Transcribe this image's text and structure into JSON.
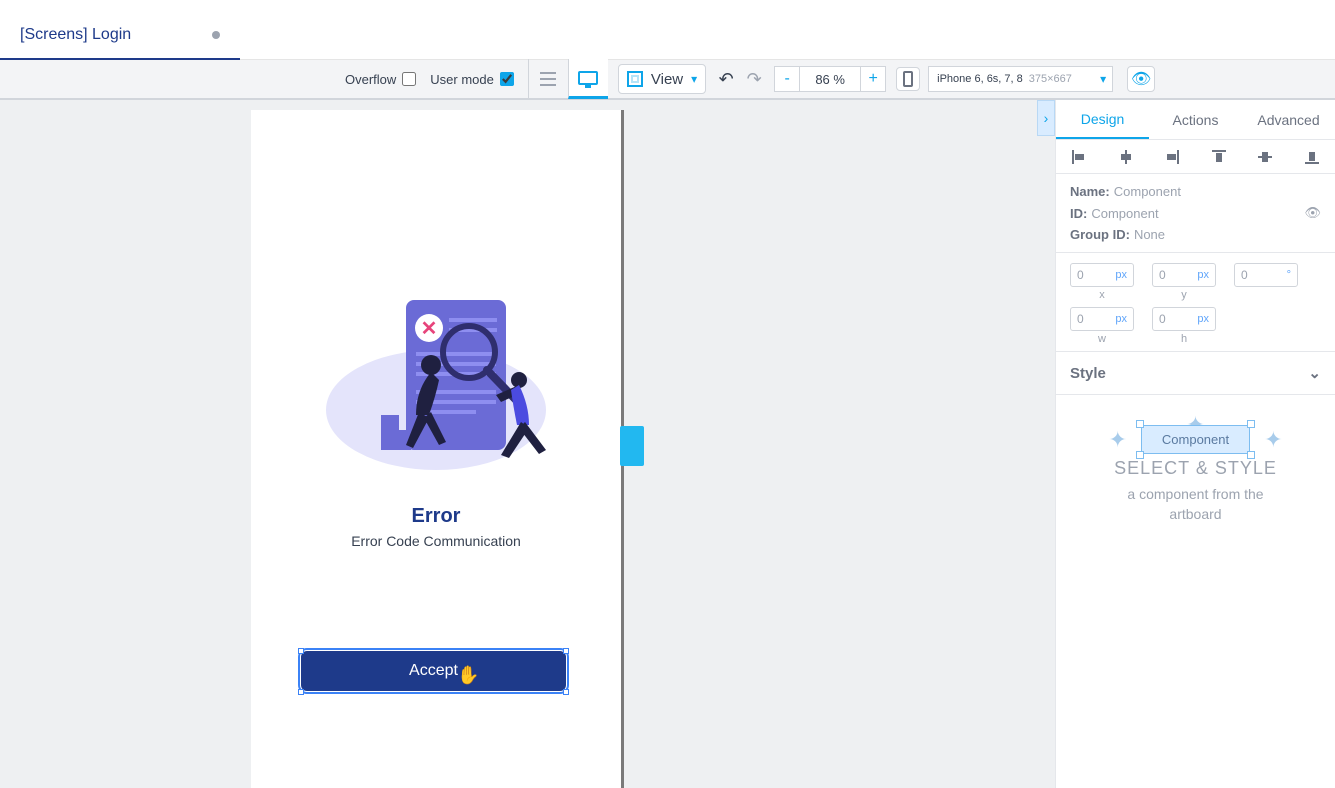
{
  "tab": {
    "title": "[Screens] Login"
  },
  "toolbar": {
    "overflow_label": "Overflow",
    "overflow_checked": false,
    "usermode_label": "User mode",
    "usermode_checked": true,
    "view_label": "View",
    "zoom_value": "86 %",
    "device_name": "iPhone 6, 6s, 7, 8",
    "device_dim": "375×667"
  },
  "artboard": {
    "error_title": "Error",
    "error_subtitle": "Error Code Communication",
    "accept_label": "Accept"
  },
  "panel": {
    "tabs": [
      "Design",
      "Actions",
      "Advanced"
    ],
    "active_tab": "Design",
    "name_label": "Name:",
    "name_value": "Component",
    "id_label": "ID:",
    "id_value": "Component",
    "group_label": "Group ID:",
    "group_value": "None",
    "x": "0",
    "y": "0",
    "rot": "0",
    "w": "0",
    "h": "0",
    "unit_px": "px",
    "unit_deg": "°",
    "dim_x": "x",
    "dim_y": "y",
    "dim_w": "w",
    "dim_h": "h",
    "style_label": "Style",
    "empty_badge": "Component",
    "empty_title": "SELECT & STYLE",
    "empty_sub1": "a component from the",
    "empty_sub2": "artboard"
  }
}
